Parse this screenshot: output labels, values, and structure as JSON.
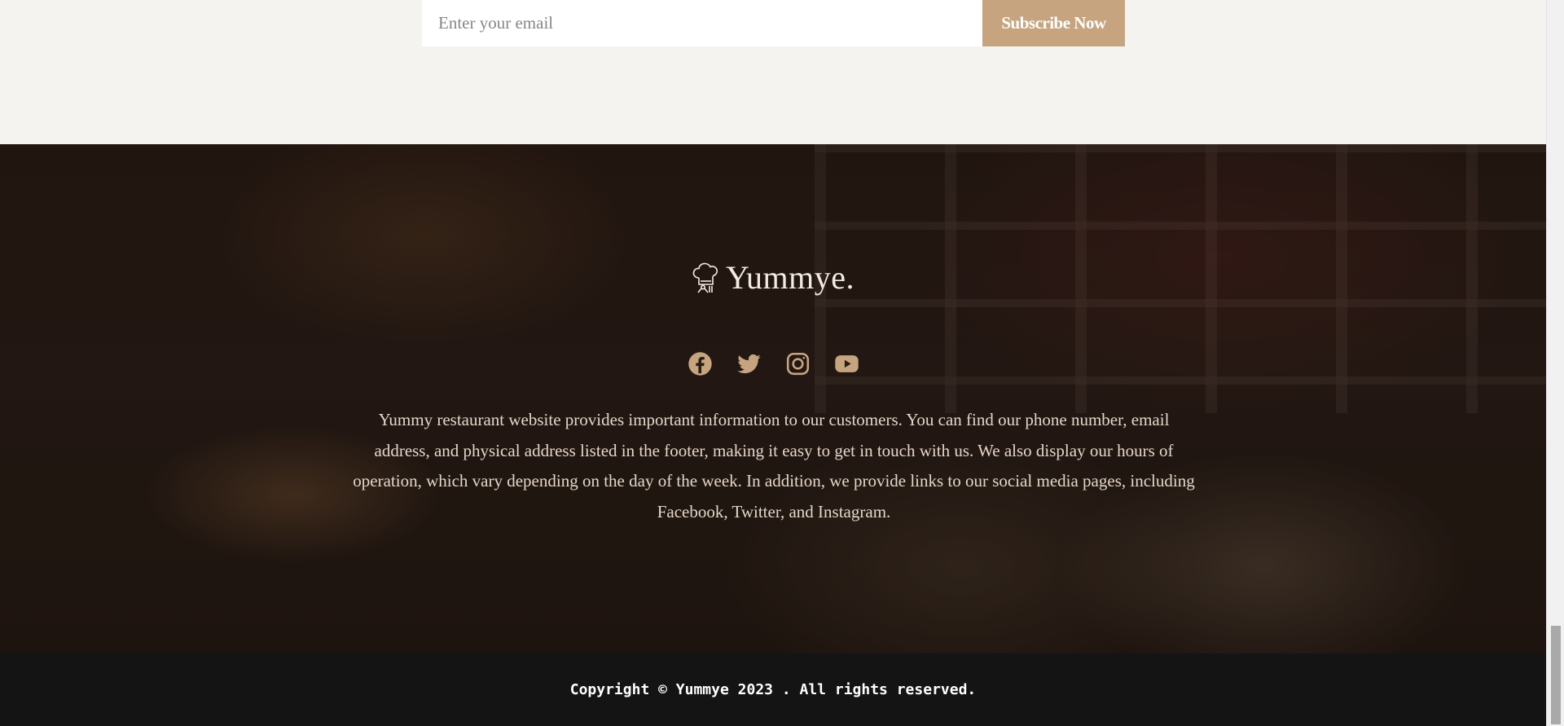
{
  "newsletter": {
    "email_placeholder": "Enter your email",
    "subscribe_label": "Subscribe Now"
  },
  "footer": {
    "brand_name": "Yummye.",
    "brand_icon": "chef-hat-icon",
    "social_icons": [
      "facebook-icon",
      "twitter-icon",
      "instagram-icon",
      "youtube-icon"
    ],
    "description": "Yummy restaurant website provides important information to our customers. You can find our phone number, email address, and physical address listed in the footer, making it easy to get in touch with us. We also display our hours of operation, which vary depending on the day of the week. In addition, we provide links to our social media pages, including Facebook, Twitter, and Instagram.",
    "copyright": "Copyright © Yummye 2023 . All rights reserved."
  },
  "colors": {
    "accent": "#c6a480",
    "page_bg": "#f5f3f0",
    "bottom_bar": "#141414"
  }
}
